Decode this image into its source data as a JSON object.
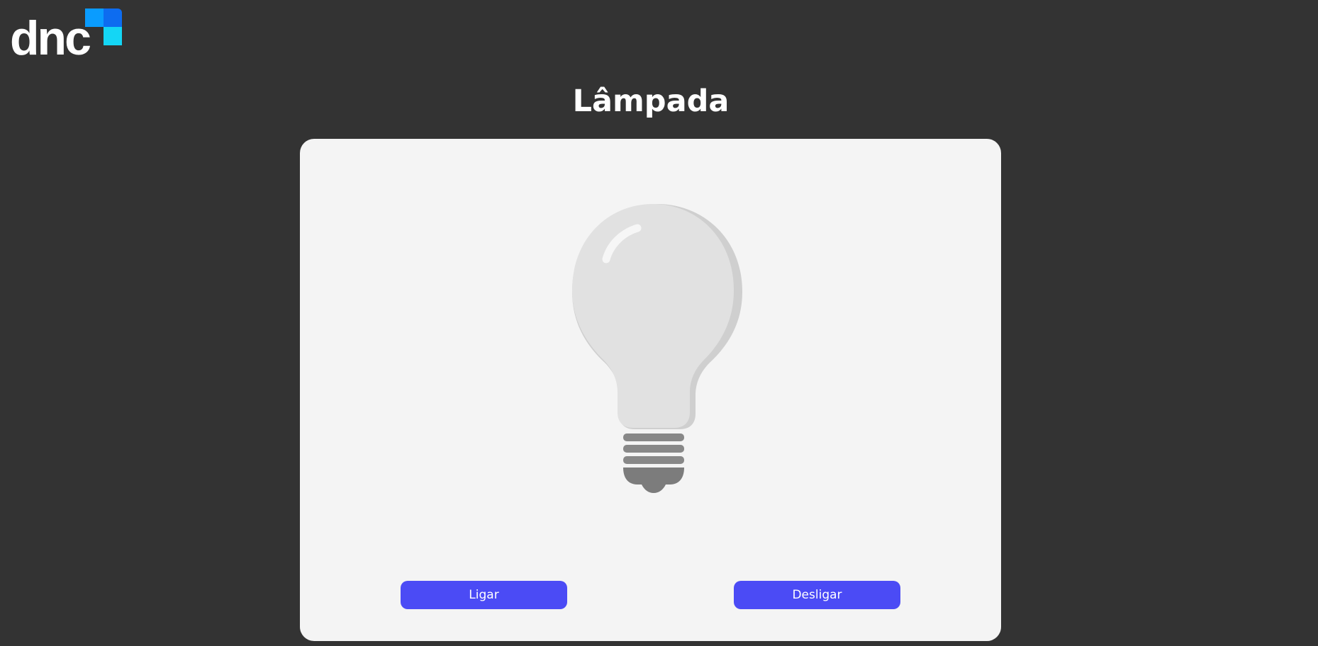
{
  "brand": {
    "logo_text": "dnc",
    "colors": [
      "#0a9cff",
      "#0d6cf0",
      "#14d6f5"
    ]
  },
  "page": {
    "title": "Lâmpada"
  },
  "lamp": {
    "state": "off",
    "icon": "lightbulb-icon"
  },
  "controls": {
    "on_label": "Ligar",
    "off_label": "Desligar",
    "accent": "#4b4bf5"
  }
}
